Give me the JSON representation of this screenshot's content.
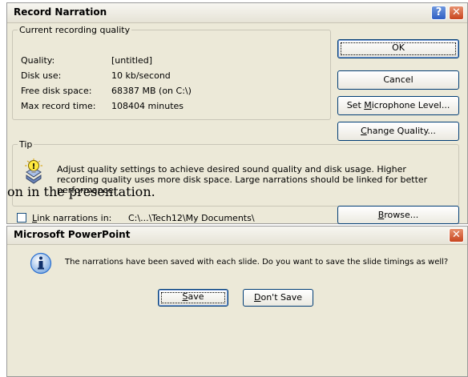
{
  "record_dialog": {
    "title": "Record Narration",
    "help_button": "?",
    "close_button": "✕",
    "quality_group": {
      "legend": "Current recording quality",
      "rows": [
        {
          "label": "Quality:",
          "value": "[untitled]"
        },
        {
          "label": "Disk use:",
          "value": "10 kb/second"
        },
        {
          "label": "Free disk space:",
          "value": "68387 MB (on C:\\)"
        },
        {
          "label": "Max record time:",
          "value": "108404 minutes"
        }
      ]
    },
    "buttons": {
      "ok": "OK",
      "cancel": "Cancel",
      "mic_prefix": "Set ",
      "mic_hotkey": "M",
      "mic_suffix": "icrophone Level...",
      "quality_hotkey": "C",
      "quality_suffix": "hange Quality...",
      "browse_hotkey": "B",
      "browse_suffix": "rowse..."
    },
    "tip_group": {
      "legend": "Tip",
      "text": "Adjust quality settings to achieve desired sound quality and disk usage. Higher recording quality uses more disk space. Large narrations should be linked for better performance."
    },
    "link_checkbox": {
      "checked": false,
      "hotkey": "L",
      "label_rest": "ink narrations in:",
      "path": "C:\\...\\Tech12\\My Documents\\"
    }
  },
  "caption_text": "on in the presentation.",
  "ppt_dialog": {
    "title": "Microsoft PowerPoint",
    "close_button": "✕",
    "message": "The narrations have been saved with each slide. Do you want to save the slide timings as well?",
    "save_hotkey": "S",
    "save_rest": "ave",
    "dont_save_hotkey": "D",
    "dont_save_rest": "on't Save"
  },
  "colors": {
    "dialog_face": "#ece9d8",
    "close_red": "#c8451f",
    "help_blue": "#2f5fc4",
    "info_blue": "#2a6fd0"
  }
}
